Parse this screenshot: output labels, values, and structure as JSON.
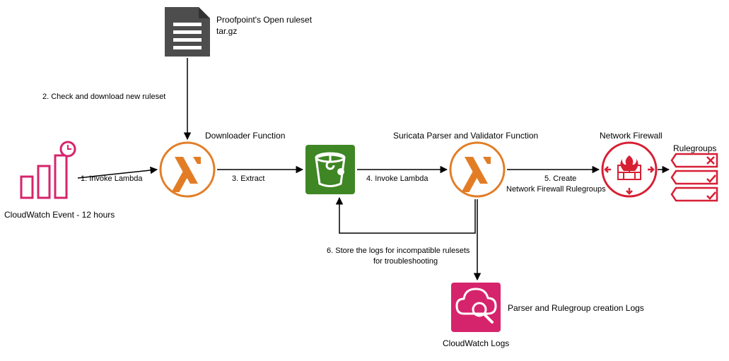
{
  "nodes": {
    "cloudwatch_event": {
      "caption": "CloudWatch Event - 12 hours"
    },
    "ruleset_file": {
      "line1": "Proofpoint's Open ruleset",
      "line2": "tar.gz"
    },
    "downloader": {
      "caption": "Downloader Function"
    },
    "s3": {
      "caption": ""
    },
    "parser": {
      "caption": "Suricata Parser and Validator Function"
    },
    "firewall": {
      "caption": "Network Firewall"
    },
    "rulegroups": {
      "caption": "Rulegroups"
    },
    "cloudwatch_logs": {
      "caption": "CloudWatch Logs",
      "side": "Parser and Rulegroup creation Logs"
    }
  },
  "edges": {
    "e1": {
      "label": "1. Invoke Lambda"
    },
    "e2": {
      "label": "2. Check and download new ruleset"
    },
    "e3": {
      "label": "3. Extract"
    },
    "e4": {
      "label": "4. Invoke Lambda"
    },
    "e5": {
      "line1": "5. Create",
      "line2": "Network Firewall Rulegroups"
    },
    "e6": {
      "line1": "6. Store the logs for incompatible rulesets",
      "line2": "for troubleshooting"
    }
  }
}
